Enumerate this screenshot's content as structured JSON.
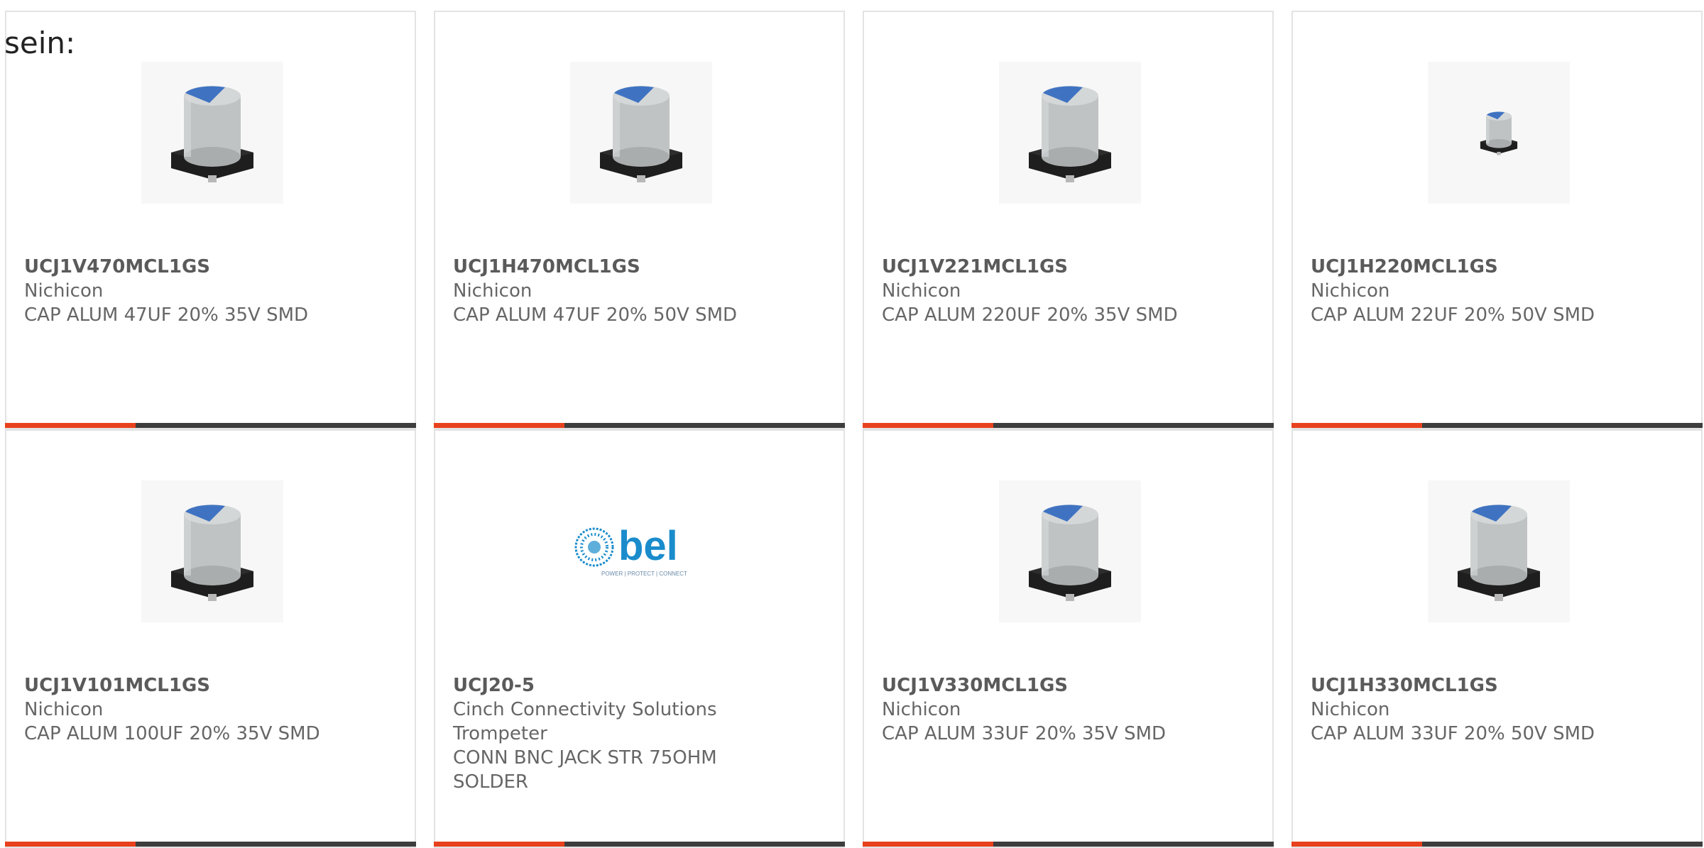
{
  "lead_text": "sein:",
  "colors": {
    "accent": "#e8411d",
    "bar": "#3d3d3d",
    "card_border": "#e3e3e3",
    "bel_blue": "#1a8ccc"
  },
  "products": [
    {
      "part_number": "UCJ1V470MCL1GS",
      "manufacturer": "Nichicon",
      "description": "CAP ALUM 47UF 20% 35V SMD",
      "image": "capacitor-icon"
    },
    {
      "part_number": "UCJ1H470MCL1GS",
      "manufacturer": "Nichicon",
      "description": "CAP ALUM 47UF 20% 50V SMD",
      "image": "capacitor-icon"
    },
    {
      "part_number": "UCJ1V221MCL1GS",
      "manufacturer": "Nichicon",
      "description": "CAP ALUM 220UF 20% 35V SMD",
      "image": "capacitor-icon"
    },
    {
      "part_number": "UCJ1H220MCL1GS",
      "manufacturer": "Nichicon",
      "description": "CAP ALUM 22UF 20% 50V SMD",
      "image": "capacitor-small-icon"
    },
    {
      "part_number": "UCJ1V101MCL1GS",
      "manufacturer": "Nichicon",
      "description": "CAP ALUM 100UF 20% 35V SMD",
      "image": "capacitor-icon"
    },
    {
      "part_number": "UCJ20-5",
      "manufacturer": "Cinch Connectivity Solutions\nTrompeter",
      "description": "CONN BNC JACK STR 75OHM\nSOLDER",
      "image": "bel-logo",
      "logo_text": "bel",
      "logo_tagline": "POWER | PROTECT | CONNECT"
    },
    {
      "part_number": "UCJ1V330MCL1GS",
      "manufacturer": "Nichicon",
      "description": "CAP ALUM 33UF 20% 35V SMD",
      "image": "capacitor-icon"
    },
    {
      "part_number": "UCJ1H330MCL1GS",
      "manufacturer": "Nichicon",
      "description": "CAP ALUM 33UF 20% 50V SMD",
      "image": "capacitor-icon"
    }
  ]
}
